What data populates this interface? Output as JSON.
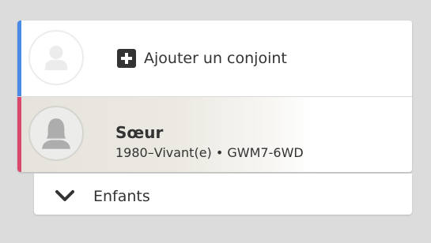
{
  "spouse": {
    "add_label": "Ajouter un conjoint",
    "accent_color": "#4b89e6"
  },
  "sister": {
    "name": "Sœur",
    "lifespan": "1980–Vivant(e)",
    "separator": "•",
    "id": "GWM7-6WD",
    "accent_color": "#d9476d"
  },
  "children": {
    "label": "Enfants"
  },
  "icons": {
    "add": "plus-square-icon",
    "avatar_empty": "person-silhouette-icon",
    "avatar_female": "female-silhouette-icon",
    "expand": "chevron-down-icon"
  }
}
